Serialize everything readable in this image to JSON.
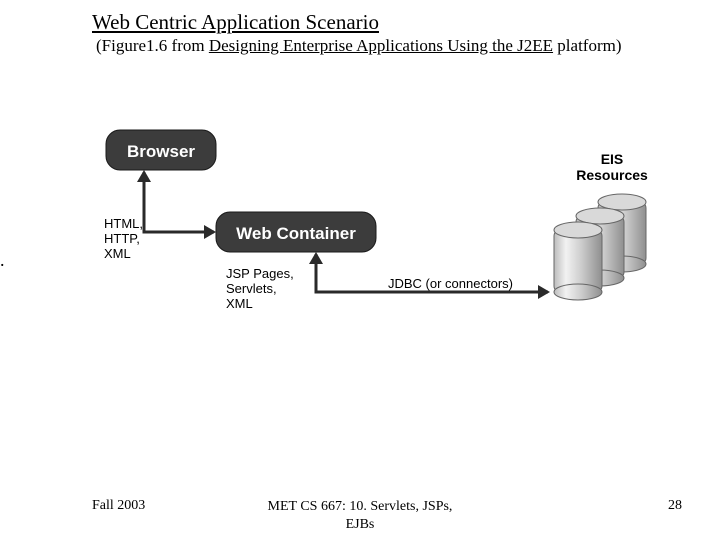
{
  "title": "Web Centric Application Scenario",
  "subtitle": {
    "prefix": "(Figure1.6 from ",
    "link": "Designing Enterprise Applications Using the  J2EE",
    "suffix": " platform)"
  },
  "diagram": {
    "nodes": {
      "browser": "Browser",
      "webContainer": "Web Container",
      "eisResources": {
        "line1": "EIS",
        "line2": "Resources"
      }
    },
    "labels": {
      "col1": {
        "l1": "HTML,",
        "l2": "HTTP,",
        "l3": "XML"
      },
      "col2": {
        "l1": "JSP Pages,",
        "l2": "Servlets,",
        "l3": "XML"
      },
      "jdbc": "JDBC (or connectors)"
    }
  },
  "side_dot": ".",
  "footer": {
    "left": "Fall 2003",
    "center_l1": "MET CS 667: 10. Servlets, JSPs,",
    "center_l2": "EJBs",
    "right": "28"
  }
}
